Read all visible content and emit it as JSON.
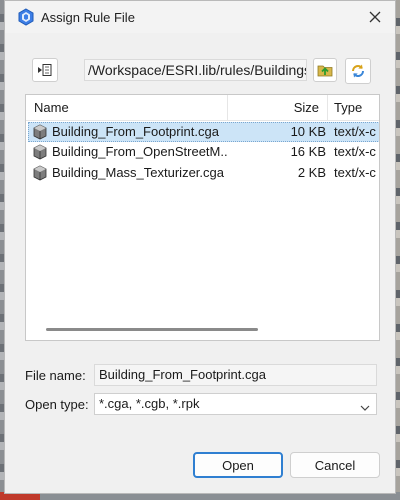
{
  "window": {
    "title": "Assign Rule File"
  },
  "toolbar": {
    "path": "/Workspace/ESRI.lib/rules/Buildings"
  },
  "columns": {
    "name": "Name",
    "size": "Size",
    "type": "Type"
  },
  "files": [
    {
      "name": "Building_From_Footprint.cga",
      "size": "10 KB",
      "type": "text/x-c",
      "selected": true
    },
    {
      "name": "Building_From_OpenStreetM...",
      "size": "16 KB",
      "type": "text/x-c",
      "selected": false
    },
    {
      "name": "Building_Mass_Texturizer.cga",
      "size": "2 KB",
      "type": "text/x-c",
      "selected": false
    }
  ],
  "form": {
    "file_name_label": "File name:",
    "file_name_value": "Building_From_Footprint.cga",
    "open_type_label": "Open type:",
    "open_type_value": "*.cga, *.cgb, *.rpk"
  },
  "buttons": {
    "open": "Open",
    "cancel": "Cancel"
  },
  "icons": {
    "app": "cityengine-app-icon",
    "close": "close-icon",
    "back": "back-icon",
    "up": "folder-up-icon",
    "refresh": "refresh-icon",
    "file": "rule-file-icon",
    "dropdown": "chevron-down-icon"
  },
  "colors": {
    "accent": "#2f7fd1",
    "selection": "#cce4f7"
  }
}
